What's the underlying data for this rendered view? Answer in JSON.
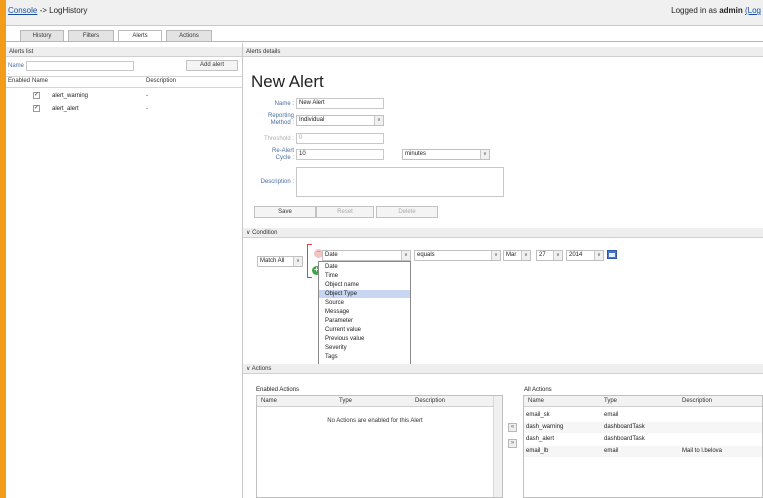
{
  "header": {
    "breadcrumb_link": "Console",
    "breadcrumb_rest": "-> LogHistory",
    "login_prefix": "Logged in as",
    "user": "admin",
    "logout_partial": "(Log"
  },
  "tabs": [
    {
      "label": "History"
    },
    {
      "label": "Filters"
    },
    {
      "label": "Alerts"
    },
    {
      "label": "Actions"
    }
  ],
  "alerts_list": {
    "title": "Alerts list",
    "name_label": "Name :",
    "name_value": "",
    "add_button": "Add alert",
    "columns": [
      "Enabled",
      "Name",
      "Description"
    ],
    "rows": [
      {
        "checked": "✓",
        "name": "alert_warning",
        "description": "-"
      },
      {
        "checked": "✓",
        "name": "alert_alert",
        "description": "-"
      }
    ]
  },
  "details": {
    "title": "Alerts details",
    "heading": "New Alert",
    "name_label": "Name :",
    "name_value": "New Alert",
    "method_label_1": "Reporting",
    "method_label_2": "Method :",
    "method_value": "Individual",
    "threshold_label": "Threshold :",
    "threshold_value": "0",
    "realert_label_1": "Re-Alert",
    "realert_label_2": "Cycle :",
    "realert_value": "10",
    "realert_unit": "minutes",
    "description_label": "Description :",
    "description_value": "",
    "save_button": "Save",
    "reset_button": "Reset",
    "delete_button": "Delete"
  },
  "condition": {
    "title": "Condition",
    "collapse_glyph": "∨",
    "match_value": "Match All",
    "field_value": "Date",
    "operator_value": "equals",
    "month_value": "Mar",
    "day_value": "27",
    "year_value": "2014",
    "dropdown_options": [
      "Date",
      "Time",
      "Object name",
      "Object Type",
      "Source",
      "Message",
      "Parameter",
      "Current value",
      "Previous value",
      "Severity",
      "Tags"
    ],
    "highlighted_option": "Object Type"
  },
  "actions": {
    "title": "Actions",
    "collapse_glyph": "∨",
    "enabled_title": "Enabled Actions",
    "enabled_columns": [
      "Name",
      "Type",
      "Description"
    ],
    "enabled_empty": "No Actions are enabled for this Alert",
    "all_title": "All Actions",
    "all_columns": [
      "Name",
      "Type",
      "Description"
    ],
    "all_rows": [
      {
        "name": "email_sk",
        "type": "email",
        "description": ""
      },
      {
        "name": "dash_warning",
        "type": "dashboardTask",
        "description": ""
      },
      {
        "name": "dash_alert",
        "type": "dashboardTask",
        "description": ""
      },
      {
        "name": "email_lb",
        "type": "email",
        "description": "Mail to l.belova"
      }
    ],
    "move_left_glyph": "«",
    "move_right_glyph": "»"
  },
  "glyphs": {
    "dropdown_arrow": "∨",
    "remove_icon": "−",
    "add_icon": "+"
  },
  "colors": {
    "outer_background": "#f39c1c",
    "label_blue": "#4a6e9e",
    "highlight": "#c8d6f2",
    "add_green": "#3fa846",
    "remove_red": "#f3c3c3"
  }
}
